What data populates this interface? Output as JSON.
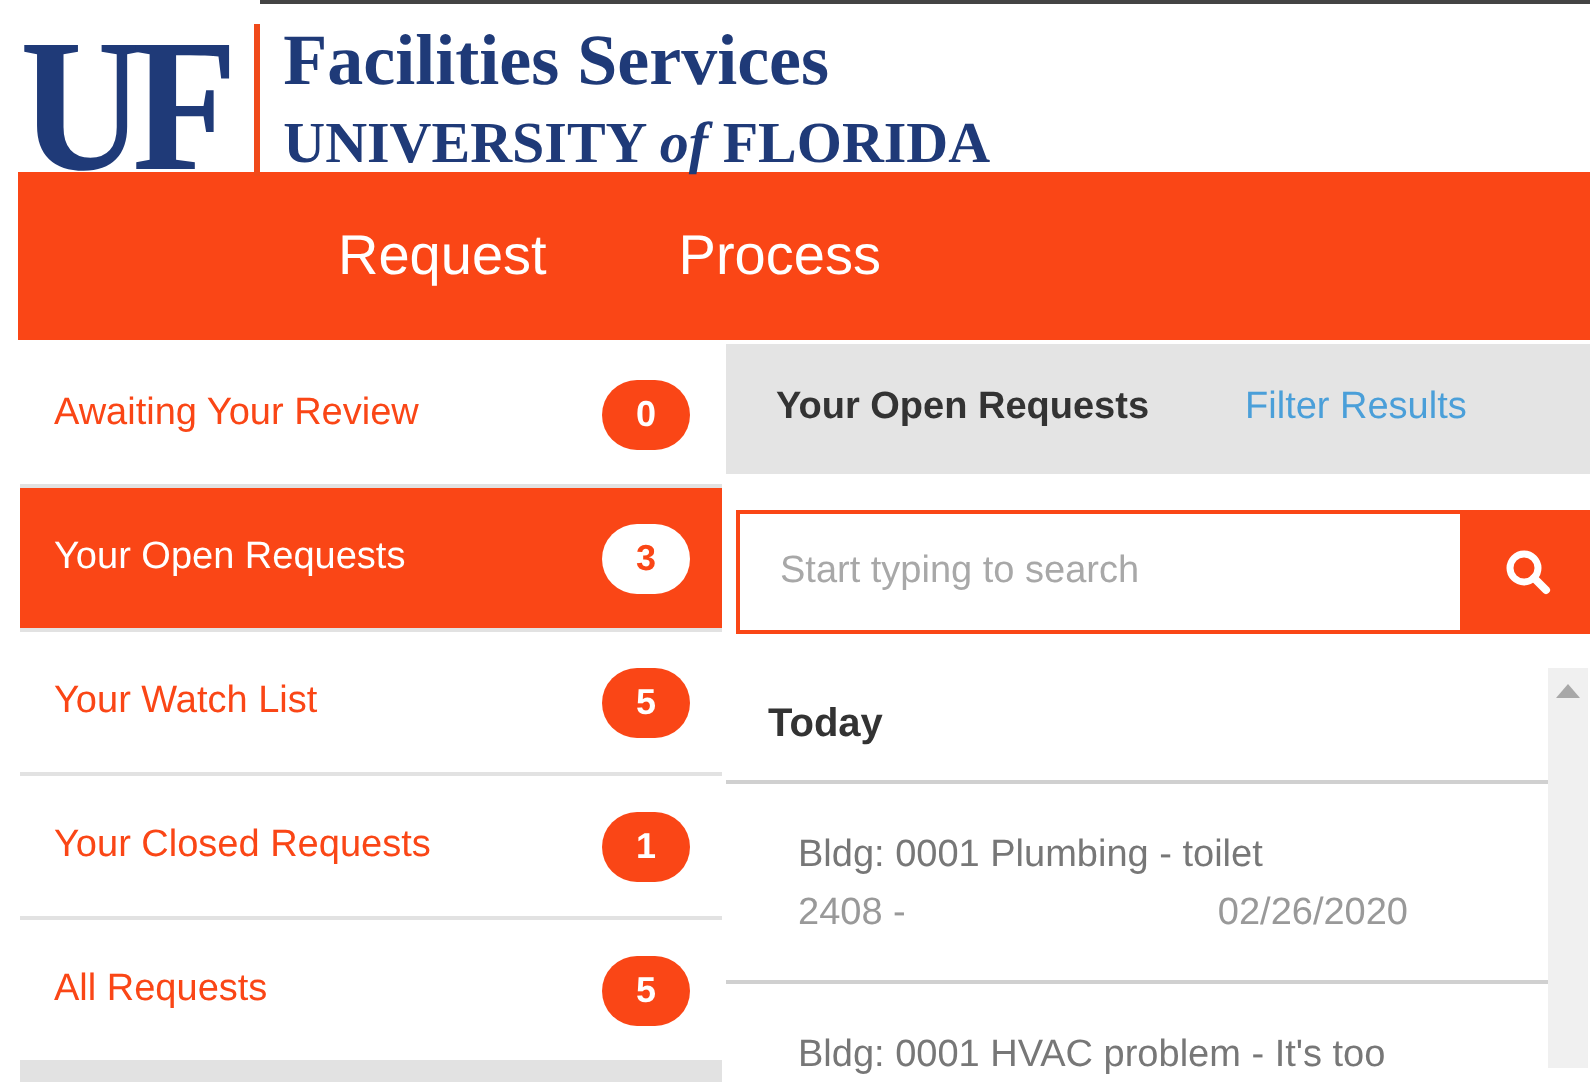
{
  "logo": {
    "mark": "UF",
    "title": "Facilities Services",
    "subtitle": "UNIVERSITY *of* FLORIDA"
  },
  "nav": [
    {
      "label": "Request"
    },
    {
      "label": "Process"
    }
  ],
  "sidebar": {
    "items": [
      {
        "label": "Awaiting Your Review",
        "count": "0",
        "selected": false
      },
      {
        "label": "Your Open Requests",
        "count": "3",
        "selected": true
      },
      {
        "label": "Your Watch List",
        "count": "5",
        "selected": false
      },
      {
        "label": "Your Closed Requests",
        "count": "1",
        "selected": false
      },
      {
        "label": "All Requests",
        "count": "5",
        "selected": false
      }
    ]
  },
  "panel": {
    "title": "Your Open Requests",
    "filter_link": "Filter Results",
    "search": {
      "placeholder": "Start typing to search"
    },
    "group": "Today",
    "requests": [
      {
        "title": "Bldg: 0001 Plumbing - toilet",
        "number": "2408 -",
        "date": "02/26/2020"
      },
      {
        "title": "Bldg: 0001 HVAC problem - It's too"
      }
    ]
  }
}
